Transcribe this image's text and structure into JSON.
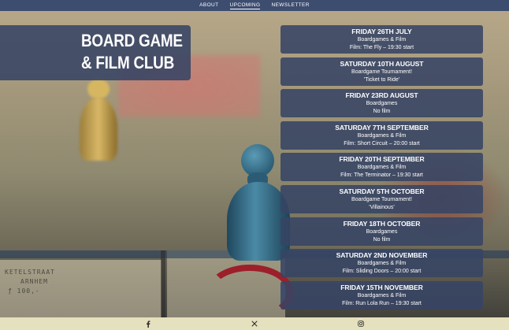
{
  "nav": {
    "items": [
      {
        "label": "ABOUT"
      },
      {
        "label": "UPCOMING"
      },
      {
        "label": "NEWSLETTER"
      }
    ],
    "active_index": 1
  },
  "header": {
    "title_line1": "BOARD GAME",
    "title_line2": "& FILM CLUB"
  },
  "background": {
    "board_text_1": "KETELSTRAAT",
    "board_text_2": "ARNHEM",
    "board_text_3": "ƒ 100,-"
  },
  "events": [
    {
      "date": "FRIDAY 26TH JULY",
      "line1": "Boardgames & Film",
      "line2": "Film: The Fly – 19:30 start"
    },
    {
      "date": "SATURDAY 10TH AUGUST",
      "line1": "Boardgame Tournament!",
      "line2": "'Ticket to Ride'"
    },
    {
      "date": "FRIDAY 23RD AUGUST",
      "line1": "Boardgames",
      "line2": "No film"
    },
    {
      "date": "SATURDAY 7TH SEPTEMBER",
      "line1": "Boardgames & Film",
      "line2": "Film: Short Circuit – 20:00 start"
    },
    {
      "date": "FRIDAY 20TH SEPTEMBER",
      "line1": "Boardgames & Film",
      "line2": "Film: The Terminator – 19:30 start"
    },
    {
      "date": "SATURDAY 5TH OCTOBER",
      "line1": "Boardgame Tournament!",
      "line2": "'Villainous'"
    },
    {
      "date": "FRIDAY 18TH OCTOBER",
      "line1": "Boardgames",
      "line2": "No film"
    },
    {
      "date": "SATURDAY 2ND NOVEMBER",
      "line1": "Boardgames & Film",
      "line2": "Film: Sliding Doors – 20:00 start"
    },
    {
      "date": "FRIDAY 15TH NOVEMBER",
      "line1": "Boardgames & Film",
      "line2": "Film: Run Lola Run – 19:30 start"
    }
  ],
  "footer": {
    "icons": [
      "facebook-icon",
      "x-icon",
      "instagram-icon"
    ]
  },
  "colors": {
    "nav_bg": "#3d4d70",
    "panel_bg": "#374464",
    "footer_bg": "#e5e0bd",
    "text": "#ffffff"
  }
}
